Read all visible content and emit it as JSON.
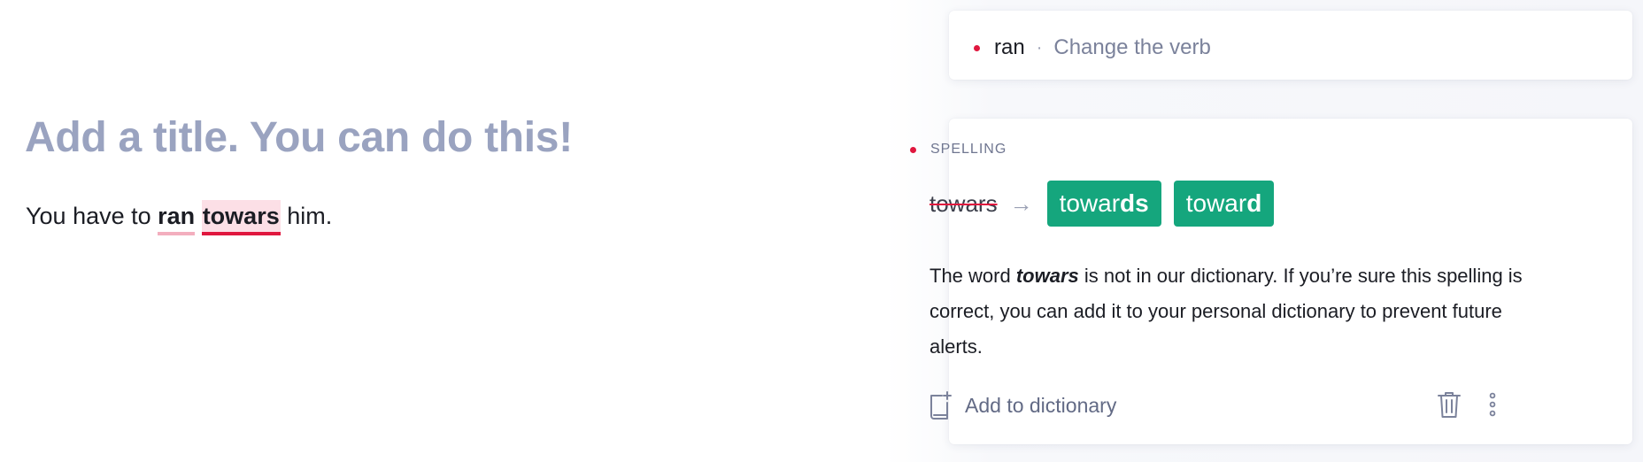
{
  "editor": {
    "title_placeholder": "Add a title. You can do this!",
    "body": {
      "text_before": "You have to ",
      "flag_word_1": "ran",
      "space": " ",
      "flag_word_2": "towars",
      "text_after": " him."
    }
  },
  "sidebar": {
    "collapsed_card": {
      "word": "ran",
      "separator": "·",
      "description": "Change the verb"
    },
    "expanded_card": {
      "category": "SPELLING",
      "original": "towars",
      "arrow": "→",
      "suggestions": [
        {
          "prefix": "towar",
          "bold": "ds"
        },
        {
          "prefix": "towar",
          "bold": "d"
        }
      ],
      "explanation": {
        "part1": "The word ",
        "word": "towars",
        "part2": " is not in our dictionary. If you’re sure this spelling is correct, you can add it to your personal dictionary to prevent future alerts."
      },
      "action_label": "Add to dictionary"
    }
  },
  "colors": {
    "alert_red": "#e0173e",
    "accept_green": "#15a67d",
    "title_gray": "#9aa3c0"
  },
  "icons": {
    "dictionary": "book-plus-icon",
    "delete": "trash-icon",
    "more": "more-vertical-icon",
    "arrow": "arrow-right-icon"
  }
}
